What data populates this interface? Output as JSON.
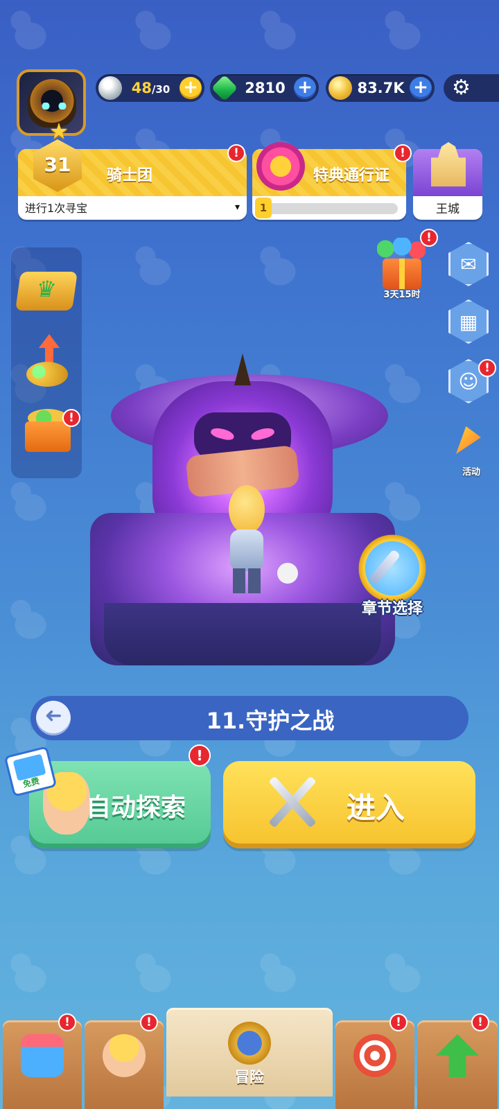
{
  "resources": {
    "energy_current": "48",
    "energy_max": "/30",
    "gems": "2810",
    "coins": "83.7K",
    "plus": "+"
  },
  "knight_card": {
    "level": "31",
    "title": "骑士团",
    "subtitle": "进行1次寻宝",
    "caret": "▾"
  },
  "pass_card": {
    "title": "特典通行证",
    "level": "1",
    "progress": 0.04
  },
  "castle_card": {
    "title": "王城"
  },
  "alert_mark": "!",
  "gift": {
    "timer": "3天15时"
  },
  "activity": {
    "label": "活动"
  },
  "chapter_select": {
    "label": "章节选择"
  },
  "chapter": {
    "title": "11.守护之战",
    "back_arrow": "➜"
  },
  "buttons": {
    "auto_explore": "自动探索",
    "free_tag": "免费",
    "enter": "进入"
  },
  "bottom_nav": {
    "active_label": "冒险"
  },
  "icons": {
    "settings": "gear-icon",
    "mail": "mail-icon",
    "backpack": "backpack-icon",
    "friends": "friends-icon",
    "shop": "shop-icon",
    "hero": "hero-icon",
    "adventure": "crossed-swords-icon",
    "archery": "target-icon",
    "upgrade": "arrow-up-icon"
  },
  "colors": {
    "alert": "#e8262f",
    "gold_button": "#f6c22d",
    "green_button": "#54c994",
    "chapter_bar": "#3a65c2"
  }
}
